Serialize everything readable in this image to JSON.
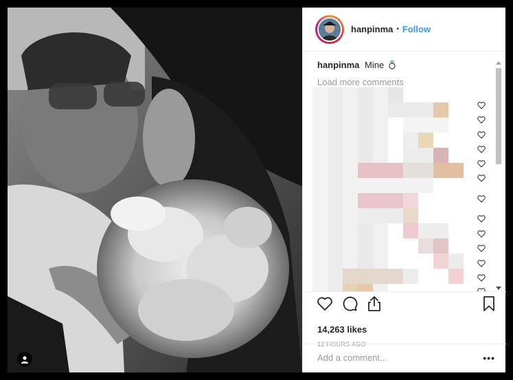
{
  "post": {
    "username": "hanpinma",
    "separator": "•",
    "follow_label": "Follow",
    "caption_user": "hanpinma",
    "caption_text": "Mine",
    "caption_emoji": "ring-icon",
    "load_more": "Load more comments",
    "likes": "14,263 likes",
    "time": "12 HOURS AGO",
    "comment_placeholder": "Add a comment...",
    "more_options": "•••"
  },
  "icons": {
    "like": "heart-icon",
    "comment": "comment-icon",
    "share": "share-icon",
    "save": "bookmark-icon",
    "user_tag": "user-tag-icon",
    "comment_like": "heart-outline-icon"
  },
  "colors": {
    "accent": "#3897f0",
    "text": "#262626",
    "muted": "#999999",
    "divider": "#efefef",
    "background": "#000000"
  }
}
